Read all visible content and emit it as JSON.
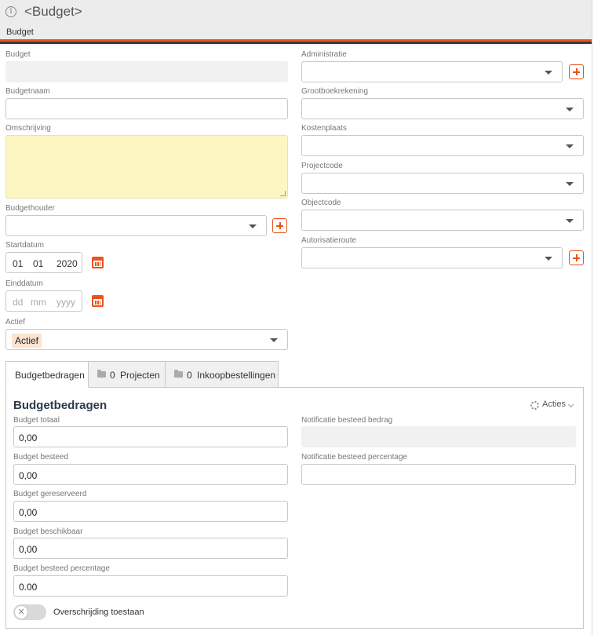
{
  "header": {
    "title": "<Budget>",
    "subtitle": "Budget",
    "info_icon": "info-icon"
  },
  "left": {
    "budget": {
      "label": "Budget",
      "value": ""
    },
    "budgetnaam": {
      "label": "Budgetnaam",
      "value": ""
    },
    "omschrijving": {
      "label": "Omschrijving",
      "value": ""
    },
    "budgethouder": {
      "label": "Budgethouder",
      "value": ""
    },
    "startdatum": {
      "label": "Startdatum",
      "dd": "01",
      "mm": "01",
      "yyyy": "2020"
    },
    "einddatum": {
      "label": "Einddatum",
      "dd": "dd",
      "mm": "mm",
      "yyyy": "yyyy"
    },
    "actief": {
      "label": "Actief",
      "value": "Actief"
    }
  },
  "right": {
    "administratie": {
      "label": "Administratie",
      "value": ""
    },
    "grootboekrekening": {
      "label": "Grootboekrekening",
      "value": ""
    },
    "kostenplaats": {
      "label": "Kostenplaats",
      "value": ""
    },
    "projectcode": {
      "label": "Projectcode",
      "value": ""
    },
    "objectcode": {
      "label": "Objectcode",
      "value": ""
    },
    "autorisatieroute": {
      "label": "Autorisatieroute",
      "value": ""
    }
  },
  "tabs": [
    {
      "label": "Budgetbedragen",
      "active": true
    },
    {
      "count": "0",
      "label": "Projecten",
      "active": false
    },
    {
      "count": "0",
      "label": "Inkoopbestellingen",
      "active": false
    }
  ],
  "panel": {
    "title": "Budgetbedragen",
    "acties": "Acties",
    "budget_totaal": {
      "label": "Budget totaal",
      "value": "0,00"
    },
    "budget_besteed": {
      "label": "Budget besteed",
      "value": "0,00"
    },
    "budget_gereserveerd": {
      "label": "Budget gereserveerd",
      "value": "0,00"
    },
    "budget_beschikbaar": {
      "label": "Budget beschikbaar",
      "value": "0,00"
    },
    "budget_besteed_percentage": {
      "label": "Budget besteed percentage",
      "value": "0.00"
    },
    "notificatie_bedrag": {
      "label": "Notificatie besteed bedrag",
      "value": ""
    },
    "notificatie_percentage": {
      "label": "Notificatie besteed percentage",
      "value": ""
    },
    "overschrijding": {
      "label": "Overschrijding toestaan",
      "enabled": false
    }
  },
  "colors": {
    "accent": "#e8531e",
    "header_bg": "#ececec",
    "note_bg": "#fdf6c3",
    "tag_bg": "#fbe3cf"
  }
}
